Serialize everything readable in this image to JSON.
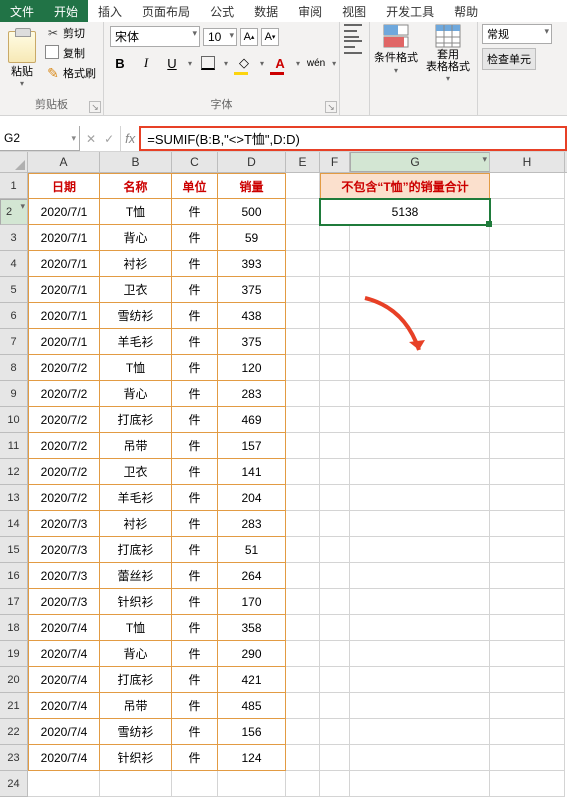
{
  "tabs": {
    "file": "文件",
    "home": "开始",
    "insert": "插入",
    "layout": "页面布局",
    "formulas": "公式",
    "data": "数据",
    "review": "审阅",
    "view": "视图",
    "dev": "开发工具",
    "help": "帮助"
  },
  "ribbon": {
    "clipboard": {
      "paste": "粘贴",
      "cut": "剪切",
      "copy": "复制",
      "brush": "格式刷",
      "label": "剪贴板"
    },
    "font": {
      "name": "宋体",
      "size": "10",
      "bold": "B",
      "italic": "I",
      "underline": "U",
      "wen": "wén",
      "label": "字体"
    },
    "styles": {
      "cond": "条件格式",
      "table": "套用\n表格格式"
    },
    "number": {
      "fmt": "常规",
      "check": "检查单元"
    }
  },
  "fx": {
    "cell": "G2",
    "cancel": "✕",
    "ok": "✓",
    "label": "fx",
    "formula": "=SUMIF(B:B,\"<>T恤\",D:D)"
  },
  "cols": [
    "A",
    "B",
    "C",
    "D",
    "E",
    "F",
    "G",
    "H"
  ],
  "headers": {
    "date": "日期",
    "name": "名称",
    "unit": "单位",
    "qty": "销量"
  },
  "result": {
    "title": "不包含“T恤”的销量合计",
    "value": "5138"
  },
  "rows": [
    {
      "n": "2",
      "d": "2020/7/1",
      "m": "T恤",
      "u": "件",
      "q": "500"
    },
    {
      "n": "3",
      "d": "2020/7/1",
      "m": "背心",
      "u": "件",
      "q": "59"
    },
    {
      "n": "4",
      "d": "2020/7/1",
      "m": "衬衫",
      "u": "件",
      "q": "393"
    },
    {
      "n": "5",
      "d": "2020/7/1",
      "m": "卫衣",
      "u": "件",
      "q": "375"
    },
    {
      "n": "6",
      "d": "2020/7/1",
      "m": "雪纺衫",
      "u": "件",
      "q": "438"
    },
    {
      "n": "7",
      "d": "2020/7/1",
      "m": "羊毛衫",
      "u": "件",
      "q": "375"
    },
    {
      "n": "8",
      "d": "2020/7/2",
      "m": "T恤",
      "u": "件",
      "q": "120"
    },
    {
      "n": "9",
      "d": "2020/7/2",
      "m": "背心",
      "u": "件",
      "q": "283"
    },
    {
      "n": "10",
      "d": "2020/7/2",
      "m": "打底衫",
      "u": "件",
      "q": "469"
    },
    {
      "n": "11",
      "d": "2020/7/2",
      "m": "吊带",
      "u": "件",
      "q": "157"
    },
    {
      "n": "12",
      "d": "2020/7/2",
      "m": "卫衣",
      "u": "件",
      "q": "141"
    },
    {
      "n": "13",
      "d": "2020/7/2",
      "m": "羊毛衫",
      "u": "件",
      "q": "204"
    },
    {
      "n": "14",
      "d": "2020/7/3",
      "m": "衬衫",
      "u": "件",
      "q": "283"
    },
    {
      "n": "15",
      "d": "2020/7/3",
      "m": "打底衫",
      "u": "件",
      "q": "51"
    },
    {
      "n": "16",
      "d": "2020/7/3",
      "m": "蕾丝衫",
      "u": "件",
      "q": "264"
    },
    {
      "n": "17",
      "d": "2020/7/3",
      "m": "针织衫",
      "u": "件",
      "q": "170"
    },
    {
      "n": "18",
      "d": "2020/7/4",
      "m": "T恤",
      "u": "件",
      "q": "358"
    },
    {
      "n": "19",
      "d": "2020/7/4",
      "m": "背心",
      "u": "件",
      "q": "290"
    },
    {
      "n": "20",
      "d": "2020/7/4",
      "m": "打底衫",
      "u": "件",
      "q": "421"
    },
    {
      "n": "21",
      "d": "2020/7/4",
      "m": "吊带",
      "u": "件",
      "q": "485"
    },
    {
      "n": "22",
      "d": "2020/7/4",
      "m": "雪纺衫",
      "u": "件",
      "q": "156"
    },
    {
      "n": "23",
      "d": "2020/7/4",
      "m": "针织衫",
      "u": "件",
      "q": "124"
    }
  ]
}
